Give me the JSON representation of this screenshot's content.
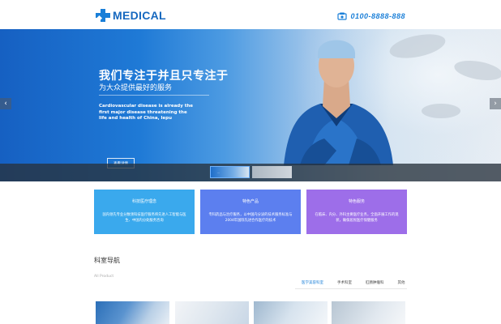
{
  "header": {
    "logo_text": "MEDICAL",
    "phone": "0100-8888-888"
  },
  "banner": {
    "headline": "我们专注于并且只专注于",
    "subheadline": "为大众提供最好的服务",
    "description": "Cardiovascular disease is already the first major disease threatening the life and health of China, lepu",
    "button_label": "查看详情",
    "prev_glyph": "‹",
    "next_glyph": "›",
    "thumb_label": "..."
  },
  "cards": [
    {
      "title": "科技医疗理念",
      "text": "国内领先专业分数领科技医疗服务将先进人工智能与医生、中国内分处服务咨询"
    },
    {
      "title": "特色产品",
      "text": "专科药品与治疗服务，以中国内分泌的技术服务标准与2004年国际先进合作医疗的技术"
    },
    {
      "title": "特色服务",
      "text": "在临床、内分、外科主要医疗业务，全面开展工作的现状，确保居民医疗保健服务"
    }
  ],
  "section": {
    "title": "科室导航",
    "subtitle": "All Product",
    "tabs": [
      "医学美容科室",
      "手术科室",
      "肛肠肿瘤科",
      "其他"
    ]
  },
  "colors": {
    "brand": "#1a7fd8",
    "card1": "#3aa9ed",
    "card2": "#5c7fef",
    "card3": "#9d6ee9"
  }
}
